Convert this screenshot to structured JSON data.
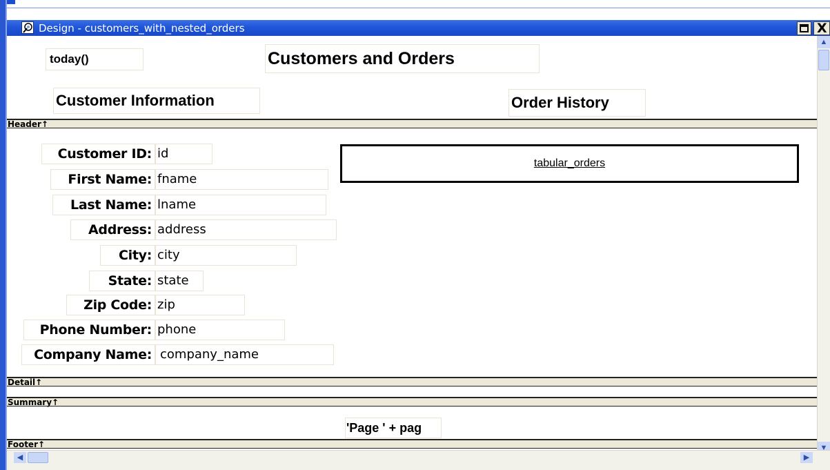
{
  "window": {
    "title": "Design - customers_with_nested_orders",
    "icon": "datawindow-design-icon",
    "maximize_icon": "maximize-icon",
    "close_icon": "close-icon",
    "close_glyph": "X"
  },
  "header": {
    "date_expr": "today()",
    "title": "Customers and Orders",
    "section_left": "Customer Information",
    "section_right": "Order History"
  },
  "bands": {
    "header": "Header↑",
    "detail": "Detail↑",
    "summary": "Summary↑",
    "footer": "Footer↑"
  },
  "detail": {
    "fields": [
      {
        "label": "Customer ID:",
        "column": "id"
      },
      {
        "label": "First Name:",
        "column": "fname"
      },
      {
        "label": "Last Name:",
        "column": "lname"
      },
      {
        "label": "Address:",
        "column": "address"
      },
      {
        "label": "City:",
        "column": "city"
      },
      {
        "label": "State:",
        "column": "state"
      },
      {
        "label": "Zip Code:",
        "column": "zip"
      },
      {
        "label": "Phone Number:",
        "column": "phone"
      },
      {
        "label": "Company Name:",
        "column": "company_name"
      }
    ],
    "nested_report": "tabular_orders"
  },
  "footer": {
    "page_expr": "'Page ' + pag"
  },
  "colors": {
    "titlebar": "#1f55d8",
    "band": "#ece9d8",
    "field_border": "#e9e4d6"
  }
}
